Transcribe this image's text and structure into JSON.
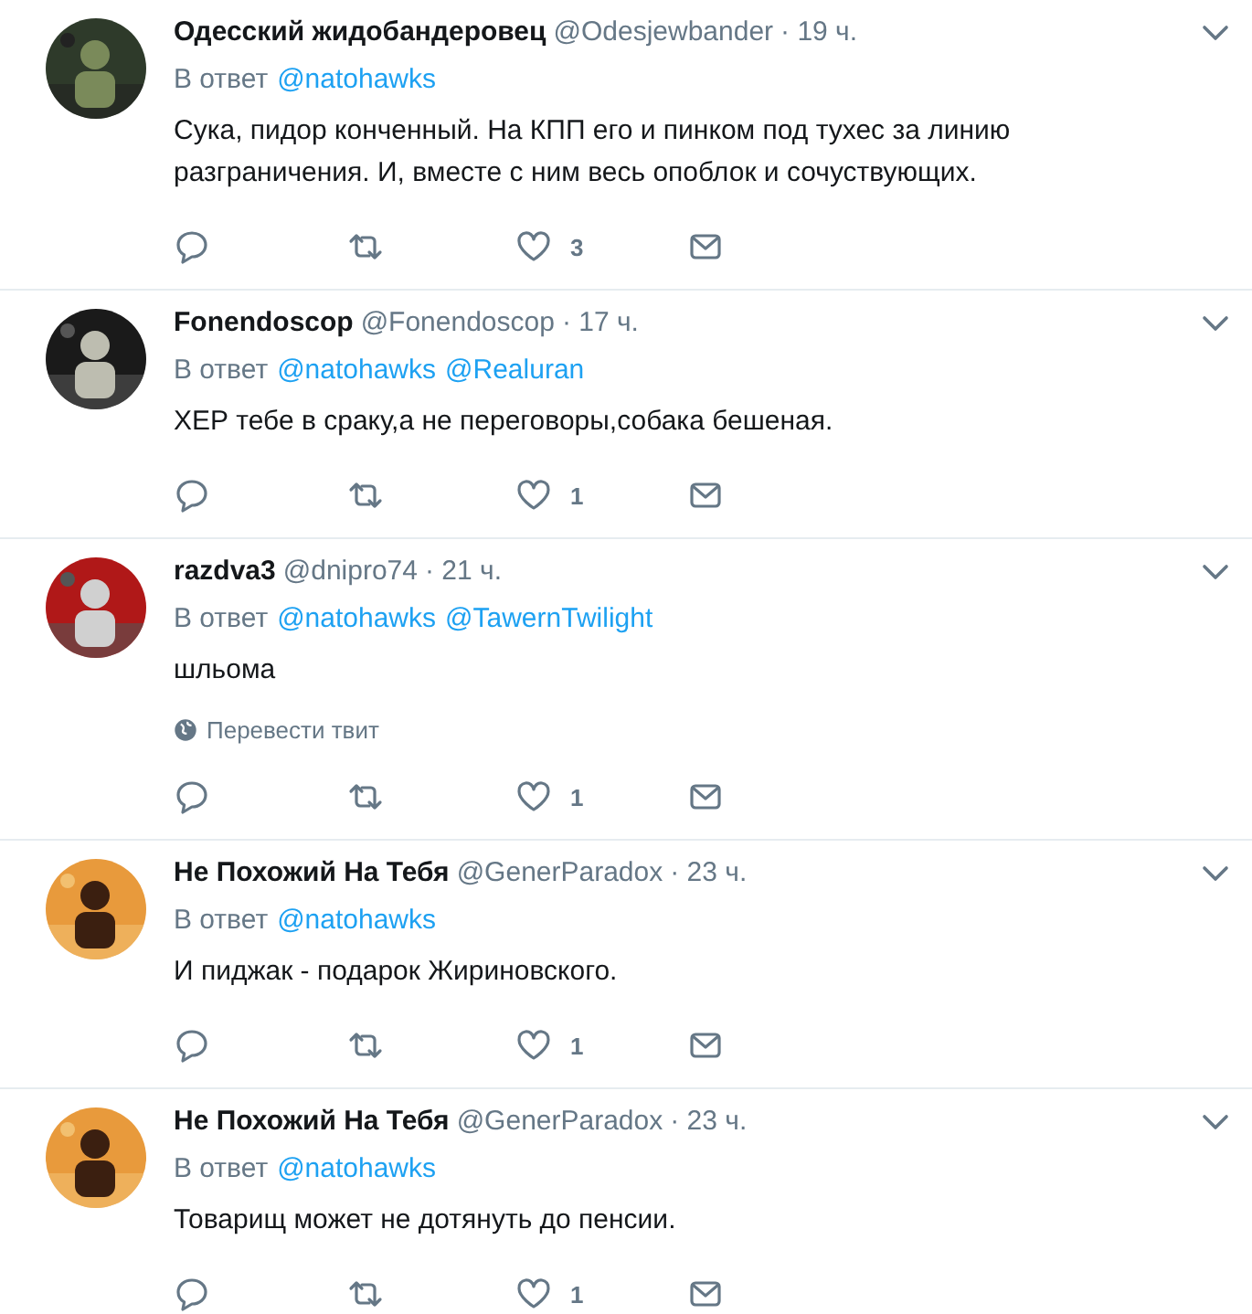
{
  "tweets": [
    {
      "name": "Одесский жидобандеровец",
      "handle": "@Odesjewbander",
      "time": "· 19 ч.",
      "reply_label": "В ответ",
      "mentions": [
        "@natohawks"
      ],
      "text": "Сука, пидор конченный. На КПП его и пинком под тухес за линию разграничения. И, вместе с ним весь опоблок и сочуствующих.",
      "likes": "3"
    },
    {
      "name": "Fonendoscop",
      "handle": "@Fonendoscop",
      "time": "· 17 ч.",
      "reply_label": "В ответ",
      "mentions": [
        "@natohawks",
        "@Realuran"
      ],
      "text": "ХЕР тебе в сраку,а не переговоры,собака бешеная.",
      "likes": "1"
    },
    {
      "name": "razdva3",
      "handle": "@dnipro74",
      "time": "· 21 ч.",
      "reply_label": "В ответ",
      "mentions": [
        "@natohawks",
        "@TawernTwilight"
      ],
      "text": "шльома",
      "translate": "Перевести твит",
      "likes": "1"
    },
    {
      "name": "Не Похожий На Тебя",
      "handle": "@GenerParadox",
      "time": "· 23 ч.",
      "reply_label": "В ответ",
      "mentions": [
        "@natohawks"
      ],
      "text": "И пиджак - подарок Жириновского.",
      "likes": "1"
    },
    {
      "name": "Не Похожий На Тебя",
      "handle": "@GenerParadox",
      "time": "· 23 ч.",
      "reply_label": "В ответ",
      "mentions": [
        "@natohawks"
      ],
      "text": "Товарищ может не дотянуть до пенсии.",
      "likes": "1"
    }
  ]
}
